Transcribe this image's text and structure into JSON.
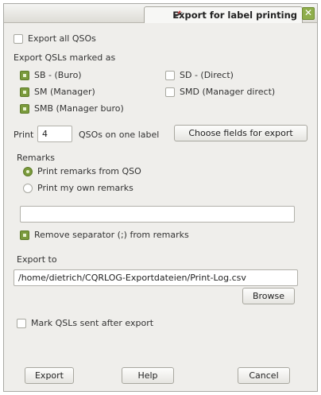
{
  "window": {
    "title": "Export for label printing",
    "close_glyph": "✕",
    "pin_icon": "pin-icon",
    "close_icon": "close-icon"
  },
  "export_all": {
    "label": "Export all QSOs",
    "checked": false
  },
  "export_marked": {
    "heading": "Export QSLs marked as",
    "options": [
      {
        "label": "SB - (Buro)",
        "checked": true
      },
      {
        "label": "SM  (Manager)",
        "checked": true
      },
      {
        "label": "SMB (Manager buro)",
        "checked": true
      },
      {
        "label": "SD - (Direct)",
        "checked": false
      },
      {
        "label": "SMD (Manager direct)",
        "checked": false
      }
    ]
  },
  "print_row": {
    "prefix": "Print",
    "value": "4",
    "suffix": "QSOs on one label",
    "choose_button": "Choose fields for export"
  },
  "remarks": {
    "heading": "Remarks",
    "options": [
      {
        "label": "Print remarks from QSO",
        "selected": true
      },
      {
        "label": "Print my own remarks",
        "selected": false
      }
    ],
    "own_remarks_value": "",
    "remove_separator": {
      "label": "Remove separator (;) from remarks",
      "checked": true
    }
  },
  "export_to": {
    "heading": "Export to",
    "path": "/home/dietrich/CQRLOG-Exportdateien/Print-Log.csv",
    "browse_button": "Browse"
  },
  "mark_sent": {
    "label": "Mark QSLs sent after export",
    "checked": false
  },
  "buttons": {
    "export": "Export",
    "help": "Help",
    "cancel": "Cancel"
  },
  "colors": {
    "accent": "#7a9a3c",
    "close_button": "#8fae4c",
    "window_bg": "#efeeeb"
  }
}
